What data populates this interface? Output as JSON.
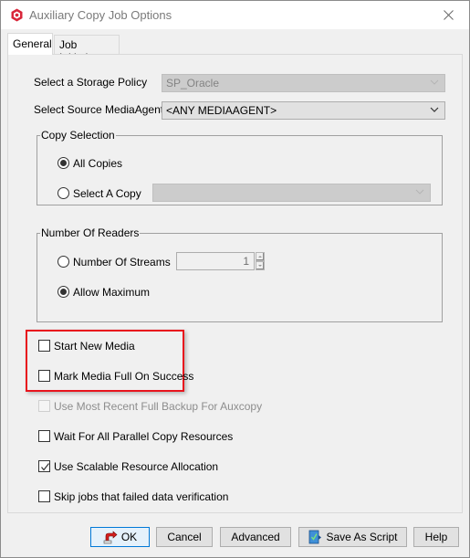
{
  "window": {
    "title": "Auxiliary Copy Job Options",
    "app_icon": "commvault-logo-icon",
    "close_icon": "close-icon"
  },
  "tabs": [
    {
      "label": "General",
      "active": true
    },
    {
      "label": "Job Initiation",
      "active": false
    }
  ],
  "form": {
    "storage_policy": {
      "label": "Select a Storage Policy",
      "value": "SP_Oracle",
      "enabled": false
    },
    "source_mediaagent": {
      "label": "Select Source MediaAgent",
      "value": "<ANY MEDIAAGENT>",
      "enabled": true
    }
  },
  "copy_selection": {
    "title": "Copy Selection",
    "all_copies": {
      "label": "All Copies",
      "selected": true
    },
    "select_a_copy": {
      "label": "Select A Copy",
      "selected": false,
      "value": ""
    }
  },
  "number_of_readers": {
    "title": "Number Of Readers",
    "number_of_streams": {
      "label": "Number Of Streams",
      "selected": false,
      "value": "1"
    },
    "allow_maximum": {
      "label": "Allow Maximum",
      "selected": true
    }
  },
  "options": [
    {
      "label": "Start New Media",
      "checked": false,
      "enabled": true
    },
    {
      "label": "Mark Media Full On Success",
      "checked": false,
      "enabled": true
    },
    {
      "label": "Use Most Recent Full Backup For Auxcopy",
      "checked": false,
      "enabled": false
    },
    {
      "label": "Wait For All Parallel Copy Resources",
      "checked": false,
      "enabled": true
    },
    {
      "label": "Use Scalable Resource Allocation",
      "checked": true,
      "enabled": true
    },
    {
      "label": "Skip jobs that failed data verification",
      "checked": false,
      "enabled": true
    }
  ],
  "buttons": {
    "ok": "OK",
    "cancel": "Cancel",
    "advanced": "Advanced",
    "save_as_script": "Save As Script",
    "help": "Help"
  },
  "colors": {
    "highlight": "#e8141d",
    "default_button_border": "#0078d7"
  }
}
